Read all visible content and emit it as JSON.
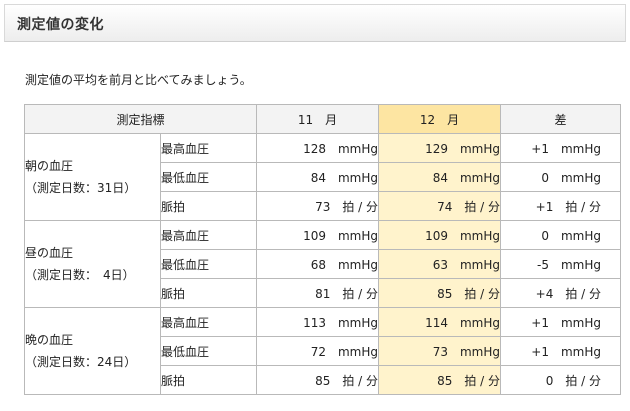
{
  "header": {
    "title": "測定値の変化"
  },
  "intro": "測定値の平均を前月と比べてみましょう。",
  "table": {
    "columns": {
      "indicator": "測定指標",
      "prev": "11　月",
      "curr": "12　月",
      "diff": "差"
    },
    "groups": [
      {
        "name": "朝の血圧",
        "days": "（測定日数：31日）",
        "rows": [
          {
            "label": "最高血圧",
            "prev": "128　mmHg",
            "curr": "129　mmHg",
            "diff": "+1　mmHg"
          },
          {
            "label": "最低血圧",
            "prev": "84　mmHg",
            "curr": "84　mmHg",
            "diff": "0　mmHg"
          },
          {
            "label": "脈拍",
            "prev": "73　拍 / 分",
            "curr": "74　拍 / 分",
            "diff": "+1　拍 / 分"
          }
        ]
      },
      {
        "name": "昼の血圧",
        "days": "（測定日数：　4日）",
        "rows": [
          {
            "label": "最高血圧",
            "prev": "109　mmHg",
            "curr": "109　mmHg",
            "diff": "0　mmHg"
          },
          {
            "label": "最低血圧",
            "prev": "68　mmHg",
            "curr": "63　mmHg",
            "diff": "-5　mmHg"
          },
          {
            "label": "脈拍",
            "prev": "81　拍 / 分",
            "curr": "85　拍 / 分",
            "diff": "+4　拍 / 分"
          }
        ]
      },
      {
        "name": "晩の血圧",
        "days": "（測定日数：24日）",
        "rows": [
          {
            "label": "最高血圧",
            "prev": "113　mmHg",
            "curr": "114　mmHg",
            "diff": "+1　mmHg"
          },
          {
            "label": "最低血圧",
            "prev": "72　mmHg",
            "curr": "73　mmHg",
            "diff": "+1　mmHg"
          },
          {
            "label": "脈拍",
            "prev": "85　拍 / 分",
            "curr": "85　拍 / 分",
            "diff": "0　拍 / 分"
          }
        ]
      }
    ]
  },
  "colors": {
    "highlight_header": "#fde5a2",
    "highlight_cell": "#fff3cc",
    "header_bg": "#f3f3f3",
    "border": "#b9b9b9"
  }
}
